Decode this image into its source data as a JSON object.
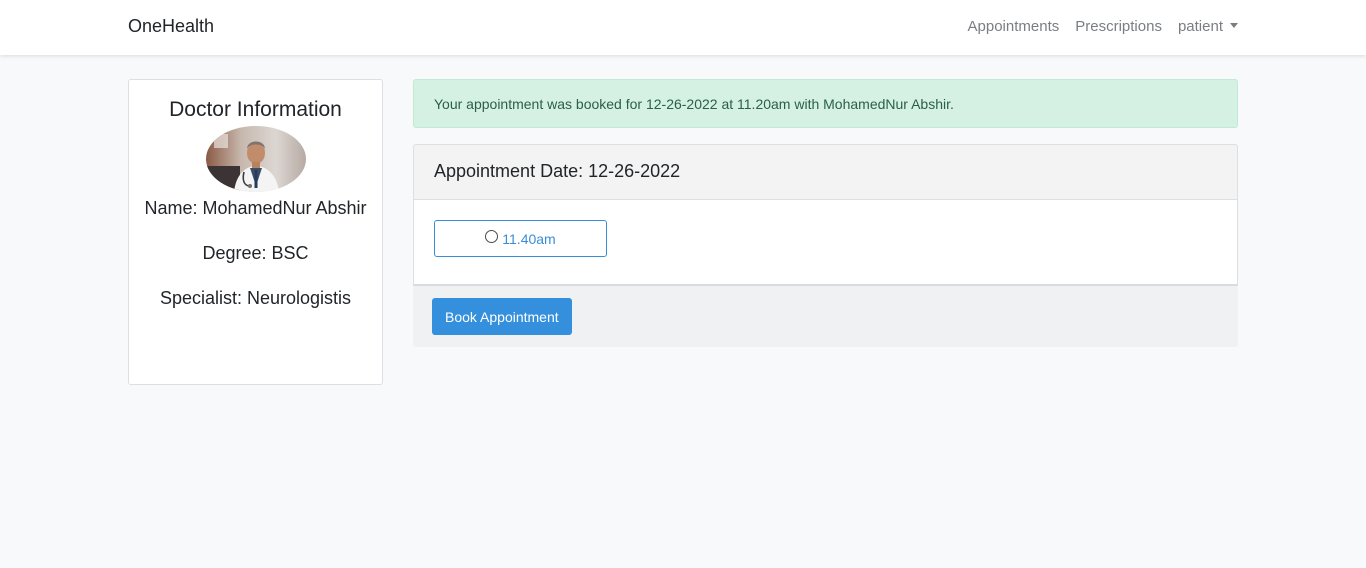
{
  "navbar": {
    "brand": "OneHealth",
    "links": {
      "appointments": "Appointments",
      "prescriptions": "Prescriptions",
      "user": "patient"
    }
  },
  "doctor": {
    "title": "Doctor Information",
    "name": "Name: MohamedNur Abshir",
    "degree": "Degree: BSC",
    "specialist": "Specialist: Neurologistis"
  },
  "alert": {
    "message": "Your appointment was booked for 12-26-2022 at 11.20am with MohamedNur Abshir."
  },
  "appointment": {
    "header": "Appointment Date: 12-26-2022",
    "slots": [
      {
        "time": "11.40am"
      }
    ],
    "book_label": "Book Appointment"
  },
  "colors": {
    "primary": "#3490dc",
    "success_bg": "#d5f1e3",
    "success_text": "#2b5f4a",
    "page_bg": "#f8f9fa"
  },
  "icons": {
    "avatar": "doctor-avatar-photo",
    "slot": "radio-circle-icon",
    "dropdown": "caret-down-icon"
  }
}
